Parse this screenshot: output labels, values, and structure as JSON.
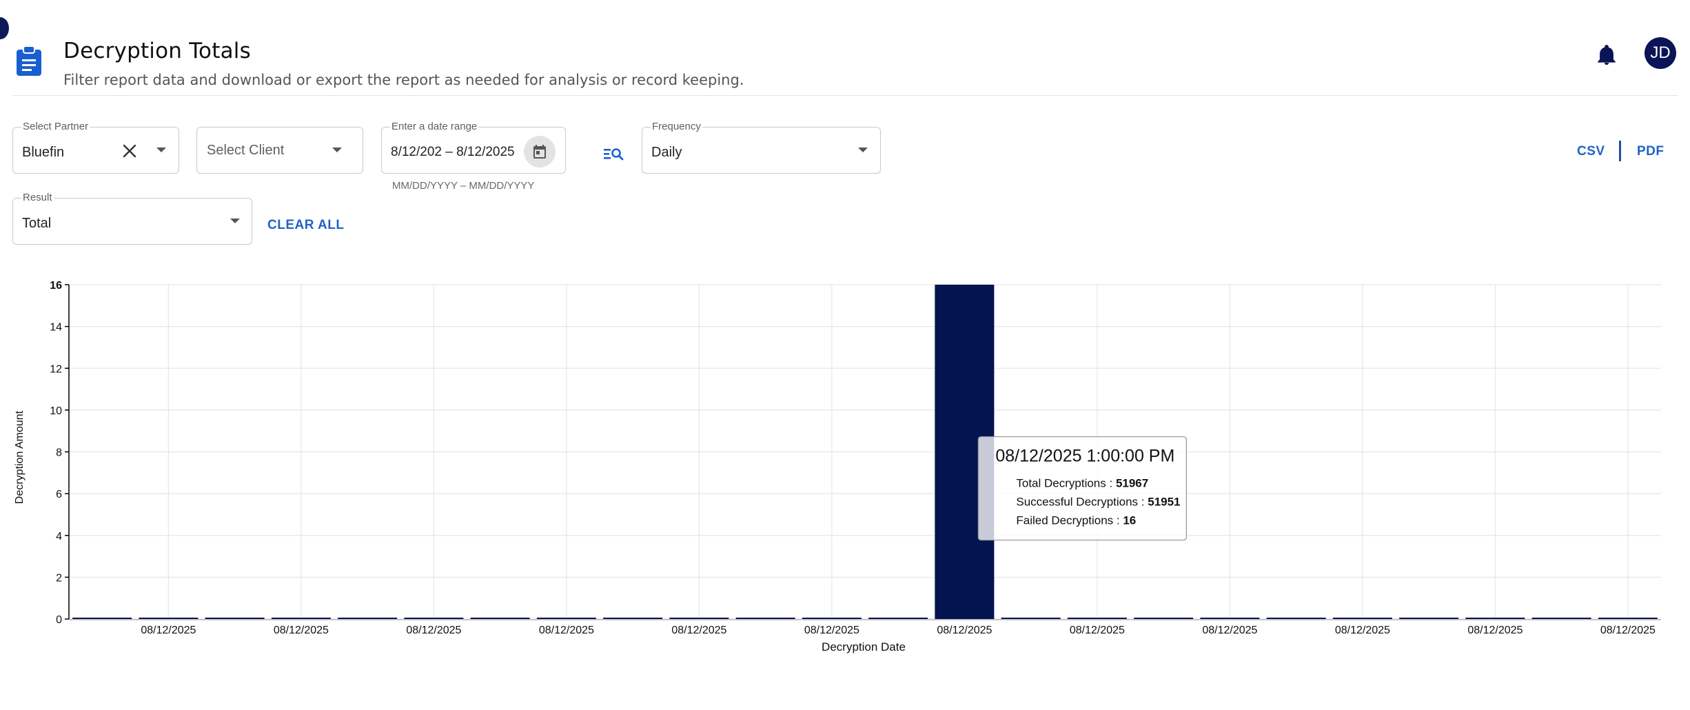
{
  "header": {
    "title": "Decryption Totals",
    "subtitle": "Filter report data and download or export the report as needed for analysis or record keeping.",
    "avatar_initials": "JD",
    "icons": [
      "clipboard-icon",
      "bell-icon"
    ],
    "accent_color": "#1a5fd1",
    "navy_color": "#0b1456"
  },
  "filters": {
    "partner": {
      "label": "Select Partner",
      "value": "Bluefin"
    },
    "client": {
      "placeholder": "Select Client"
    },
    "date_range": {
      "label": "Enter a date range",
      "value": "8/12/202 – 8/12/2025",
      "hint": "MM/DD/YYYY – MM/DD/YYYY"
    },
    "frequency": {
      "label": "Frequency",
      "value": "Daily"
    },
    "result": {
      "label": "Result",
      "value": "Total"
    },
    "clear_all": "CLEAR ALL"
  },
  "export": {
    "csv": "CSV",
    "pdf": "PDF"
  },
  "chart_data": {
    "type": "bar",
    "xlabel": "Decryption Date",
    "ylabel": "Decryption Amount",
    "ylim": [
      0,
      16
    ],
    "yticks": [
      0,
      2,
      4,
      6,
      8,
      10,
      12,
      14,
      16
    ],
    "grid": true,
    "bar_color": "#03144f",
    "categories": [
      "",
      "08/12/2025",
      "",
      "08/12/2025",
      "",
      "08/12/2025",
      "",
      "08/12/2025",
      "",
      "08/12/2025",
      "",
      "08/12/2025",
      "",
      "08/12/2025",
      "",
      "08/12/2025",
      "",
      "08/12/2025",
      "",
      "08/12/2025",
      "",
      "08/12/2025",
      "",
      "08/12/2025"
    ],
    "values": [
      0,
      0,
      0,
      0,
      0,
      0,
      0,
      0,
      0,
      0,
      0,
      0,
      0,
      16,
      0,
      0,
      0,
      0,
      0,
      0,
      0,
      0,
      0,
      0
    ],
    "tooltip": {
      "title": "08/12/2025 1:00:00 PM",
      "rows": [
        {
          "label": "Total Decryptions : ",
          "value": "51967"
        },
        {
          "label": "Successful Decryptions : ",
          "value": "51951"
        },
        {
          "label": "Failed Decryptions : ",
          "value": "16"
        }
      ]
    }
  }
}
